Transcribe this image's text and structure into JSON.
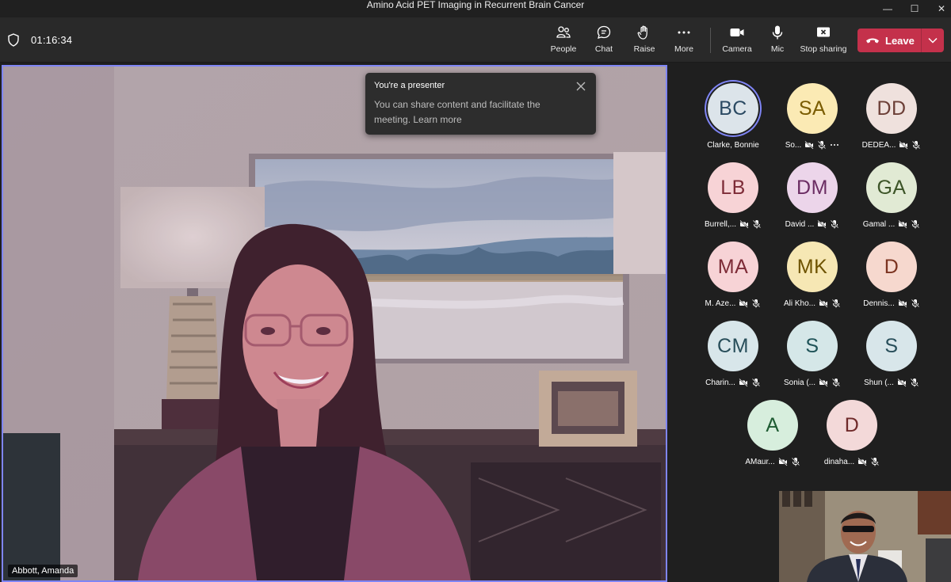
{
  "window": {
    "title": "Amino Acid PET Imaging in Recurrent Brain Cancer",
    "minimize": "—",
    "maximize": "☐",
    "close": "✕"
  },
  "toolbar": {
    "timer": "01:16:34",
    "people": "People",
    "chat": "Chat",
    "raise": "Raise",
    "more": "More",
    "camera": "Camera",
    "mic": "Mic",
    "stop_sharing": "Stop sharing",
    "leave": "Leave"
  },
  "toast": {
    "title": "You're a presenter",
    "body": "You can share content and facilitate the meeting. Learn more"
  },
  "main_video": {
    "name": "Abbott, Amanda"
  },
  "participants": [
    {
      "initials": "BC",
      "name": "Clarke, Bonnie",
      "bg": "#dce4ea",
      "fg": "#2b4a63",
      "active": true,
      "icons": false,
      "more": false
    },
    {
      "initials": "SA",
      "name": "So...",
      "bg": "#fbeab4",
      "fg": "#7a5c00",
      "active": false,
      "icons": true,
      "more": true
    },
    {
      "initials": "DD",
      "name": "DEDEA...",
      "bg": "#efe1dd",
      "fg": "#6c3f37",
      "active": false,
      "icons": true,
      "more": false
    },
    {
      "initials": "LB",
      "name": "Burrell,...",
      "bg": "#f7d3d6",
      "fg": "#7d2b37",
      "active": false,
      "icons": true,
      "more": false
    },
    {
      "initials": "DM",
      "name": "David ...",
      "bg": "#ecd5ea",
      "fg": "#6b2d63",
      "active": false,
      "icons": true,
      "more": false
    },
    {
      "initials": "GA",
      "name": "Gamal ...",
      "bg": "#e1ead4",
      "fg": "#3d5528",
      "active": false,
      "icons": true,
      "more": false
    },
    {
      "initials": "MA",
      "name": "M. Aze...",
      "bg": "#f7d3d6",
      "fg": "#7d2b37",
      "active": false,
      "icons": true,
      "more": false
    },
    {
      "initials": "MK",
      "name": "Ali Kho...",
      "bg": "#f6e7b4",
      "fg": "#6e5300",
      "active": false,
      "icons": true,
      "more": false
    },
    {
      "initials": "D",
      "name": "Dennis...",
      "bg": "#f6d8ce",
      "fg": "#7b3320",
      "active": false,
      "icons": true,
      "more": false
    },
    {
      "initials": "CM",
      "name": "Charin...",
      "bg": "#d8e6ea",
      "fg": "#284e5a",
      "active": false,
      "icons": true,
      "more": false
    },
    {
      "initials": "S",
      "name": "Sonia (...",
      "bg": "#d5e7e8",
      "fg": "#1f5358",
      "active": false,
      "icons": true,
      "more": false
    },
    {
      "initials": "S",
      "name": "Shun (...",
      "bg": "#d8e6ea",
      "fg": "#284e5a",
      "active": false,
      "icons": true,
      "more": false
    },
    {
      "initials": "A",
      "name": "AMaur...",
      "bg": "#d7eedd",
      "fg": "#1f5c33",
      "active": false,
      "icons": true,
      "more": false
    },
    {
      "initials": "D",
      "name": "dinaha...",
      "bg": "#f3d9d9",
      "fg": "#6f2a2a",
      "active": false,
      "icons": true,
      "more": false
    }
  ],
  "colors": {
    "accent": "#7f85f5",
    "leave": "#c4314b",
    "toolbar": "#292929",
    "stage": "#1f1f1f"
  },
  "icons": {
    "shield": "shield-icon",
    "people": "people-icon",
    "chat": "chat-icon",
    "raise": "hand-icon",
    "more": "more-icon",
    "camera": "camera-icon",
    "mic": "mic-icon",
    "stop_sharing": "stop-share-icon",
    "leave": "phone-hangup-icon"
  }
}
